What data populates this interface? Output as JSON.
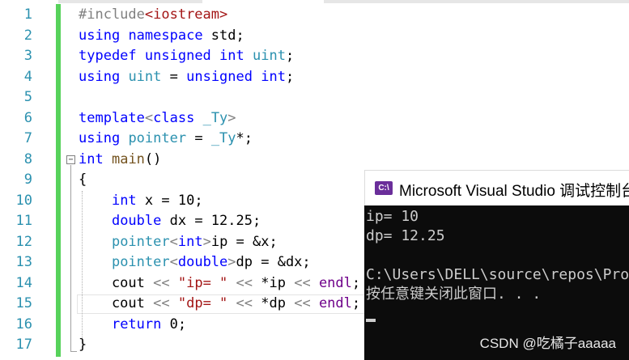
{
  "editor": {
    "lines": [
      {
        "num": "1",
        "tokens": [
          [
            "inc",
            "#include"
          ],
          [
            "angle",
            "<iostream>"
          ]
        ]
      },
      {
        "num": "2",
        "tokens": [
          [
            "kw",
            "using"
          ],
          [
            "",
            " "
          ],
          [
            "kw",
            "namespace"
          ],
          [
            "",
            " std;"
          ]
        ]
      },
      {
        "num": "3",
        "tokens": [
          [
            "kw",
            "typedef"
          ],
          [
            "",
            " "
          ],
          [
            "kw",
            "unsigned"
          ],
          [
            "",
            " "
          ],
          [
            "kw",
            "int"
          ],
          [
            "",
            " "
          ],
          [
            "ty",
            "uint"
          ],
          [
            "",
            ";"
          ]
        ]
      },
      {
        "num": "4",
        "tokens": [
          [
            "kw",
            "using"
          ],
          [
            "",
            " "
          ],
          [
            "ty",
            "uint"
          ],
          [
            "",
            " = "
          ],
          [
            "kw",
            "unsigned"
          ],
          [
            "",
            " "
          ],
          [
            "kw",
            "int"
          ],
          [
            "",
            ";"
          ]
        ]
      },
      {
        "num": "5",
        "tokens": []
      },
      {
        "num": "6",
        "tokens": [
          [
            "kw",
            "template"
          ],
          [
            "par",
            "<"
          ],
          [
            "kw",
            "class"
          ],
          [
            "",
            " "
          ],
          [
            "ty",
            "_Ty"
          ],
          [
            "par",
            ">"
          ]
        ]
      },
      {
        "num": "7",
        "tokens": [
          [
            "kw",
            "using"
          ],
          [
            "",
            " "
          ],
          [
            "ty",
            "pointer"
          ],
          [
            "",
            " = "
          ],
          [
            "ty",
            "_Ty"
          ],
          [
            "",
            "*;"
          ]
        ]
      },
      {
        "num": "8",
        "tokens": [
          [
            "kw",
            "int"
          ],
          [
            "",
            " "
          ],
          [
            "fn",
            "main"
          ],
          [
            "",
            "()"
          ]
        ]
      },
      {
        "num": "9",
        "tokens": [
          [
            "",
            "{"
          ]
        ]
      },
      {
        "num": "10",
        "tokens": [
          [
            "",
            "    "
          ],
          [
            "kw",
            "int"
          ],
          [
            "",
            " x = 10;"
          ]
        ]
      },
      {
        "num": "11",
        "tokens": [
          [
            "",
            "    "
          ],
          [
            "kw",
            "double"
          ],
          [
            "",
            " dx = 12.25;"
          ]
        ]
      },
      {
        "num": "12",
        "tokens": [
          [
            "",
            "    "
          ],
          [
            "ty",
            "pointer"
          ],
          [
            "par",
            "<"
          ],
          [
            "kw",
            "int"
          ],
          [
            "par",
            ">"
          ],
          [
            "",
            "ip = &x;"
          ]
        ]
      },
      {
        "num": "13",
        "tokens": [
          [
            "",
            "    "
          ],
          [
            "ty",
            "pointer"
          ],
          [
            "par",
            "<"
          ],
          [
            "kw",
            "double"
          ],
          [
            "par",
            ">"
          ],
          [
            "",
            "dp = &dx;"
          ]
        ]
      },
      {
        "num": "14",
        "tokens": [
          [
            "",
            "    cout "
          ],
          [
            "par",
            "<<"
          ],
          [
            "",
            " "
          ],
          [
            "str",
            "\"ip= \""
          ],
          [
            "",
            " "
          ],
          [
            "par",
            "<<"
          ],
          [
            "",
            " *ip "
          ],
          [
            "par",
            "<<"
          ],
          [
            "",
            " "
          ],
          [
            "mac",
            "endl"
          ],
          [
            "",
            ";"
          ]
        ]
      },
      {
        "num": "15",
        "tokens": [
          [
            "",
            "    cout "
          ],
          [
            "par",
            "<<"
          ],
          [
            "",
            " "
          ],
          [
            "str",
            "\"dp= \""
          ],
          [
            "",
            " "
          ],
          [
            "par",
            "<<"
          ],
          [
            "",
            " *dp "
          ],
          [
            "par",
            "<<"
          ],
          [
            "",
            " "
          ],
          [
            "mac",
            "endl"
          ],
          [
            "",
            ";"
          ]
        ]
      },
      {
        "num": "16",
        "tokens": [
          [
            "",
            "    "
          ],
          [
            "kw",
            "return"
          ],
          [
            "",
            " 0;"
          ]
        ]
      },
      {
        "num": "17",
        "tokens": [
          [
            "",
            "}"
          ]
        ]
      }
    ],
    "collapse_symbol": "−"
  },
  "console": {
    "icon_text": "C:\\",
    "title": "Microsoft Visual Studio 调试控制台",
    "output_lines": [
      "ip= 10",
      "dp= 12.25",
      "",
      "C:\\Users\\DELL\\source\\repos\\Pro",
      "按任意键关闭此窗口. . ."
    ]
  },
  "watermark": "CSDN @吃橘子aaaaa",
  "colors": {
    "keyword": "#0000ff",
    "type": "#2b91af",
    "string": "#a31515",
    "macro": "#6f008a",
    "console_bg": "#0c0c0c",
    "change_bar": "#57d25b"
  }
}
